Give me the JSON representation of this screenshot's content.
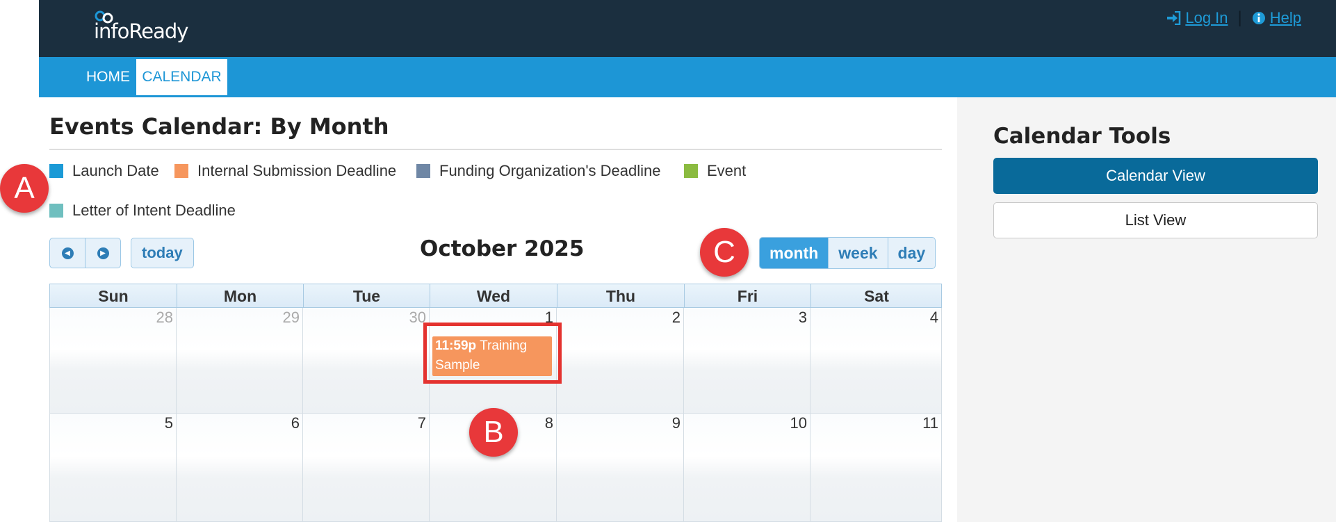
{
  "header": {
    "logo_text": "infoReady",
    "login_label": " Log In",
    "help_label": " Help",
    "separator": "|"
  },
  "nav": {
    "home_label": "HOME",
    "calendar_label": "CALENDAR"
  },
  "main": {
    "title": "Events Calendar: By Month",
    "legend": [
      {
        "label": "Launch Date",
        "color": "#1b9ad6"
      },
      {
        "label": "Internal Submission Deadline",
        "color": "#f6965d"
      },
      {
        "label": "Funding Organization's Deadline",
        "color": "#6f87a5"
      },
      {
        "label": "Event",
        "color": "#8bbb40"
      },
      {
        "label": "Letter of Intent Deadline",
        "color": "#6fbfbf"
      }
    ],
    "today_label": "today",
    "month_title": "October 2025",
    "views": [
      "month",
      "week",
      "day"
    ],
    "active_view": "month"
  },
  "calendar": {
    "day_headers": [
      "Sun",
      "Mon",
      "Tue",
      "Wed",
      "Thu",
      "Fri",
      "Sat"
    ],
    "weeks": [
      [
        "28",
        "29",
        "30",
        "1",
        "2",
        "3",
        "4"
      ],
      [
        "5",
        "6",
        "7",
        "8",
        "9",
        "10",
        "11"
      ]
    ],
    "event": {
      "time": "11:59p",
      "title": "Training Sample",
      "color": "#f6965d"
    }
  },
  "right_panel": {
    "title": "Calendar Tools",
    "calendar_view_label": "Calendar View",
    "list_view_label": "List View"
  },
  "markers": {
    "a": "A",
    "b": "B",
    "c": "C"
  }
}
